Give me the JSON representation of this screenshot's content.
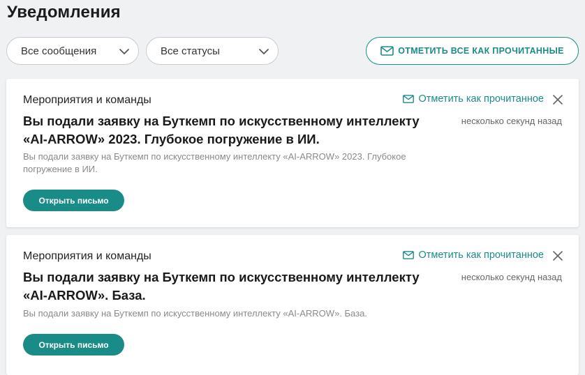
{
  "page": {
    "title": "Уведомления"
  },
  "filters": {
    "messages": "Все сообщения",
    "statuses": "Все статусы"
  },
  "actions": {
    "mark_all_read": "ОТМЕТИТЬ ВСЕ КАК ПРОЧИТАННЫЕ"
  },
  "notifications": [
    {
      "category": "Мероприятия и команды",
      "mark_read": "Отметить как прочитанное",
      "title": "Вы подали заявку на Буткемп по искусственному интеллекту «AI-ARROW» 2023. Глубокое погружение в ИИ.",
      "time": "несколько секунд назад",
      "description": "Вы подали заявку на Буткемп по искусственному интеллекту «AI-ARROW» 2023. Глубокое погружение в ИИ.",
      "open_label": "Открыть письмо"
    },
    {
      "category": "Мероприятия и команды",
      "mark_read": "Отметить как прочитанное",
      "title": "Вы подали заявку на Буткемп по искусственному интеллекту «AI-ARROW». База.",
      "time": "несколько секунд назад",
      "description": "Вы подали заявку на Буткемп по искусственному интеллекту «AI-ARROW». База.",
      "open_label": "Открыть письмо"
    }
  ],
  "icons": {
    "chevron": "chevron-down-icon",
    "mail": "mail-icon",
    "close": "close-icon"
  },
  "colors": {
    "accent": "#1a8c87",
    "background": "#f0f1f3",
    "card": "#ffffff"
  }
}
